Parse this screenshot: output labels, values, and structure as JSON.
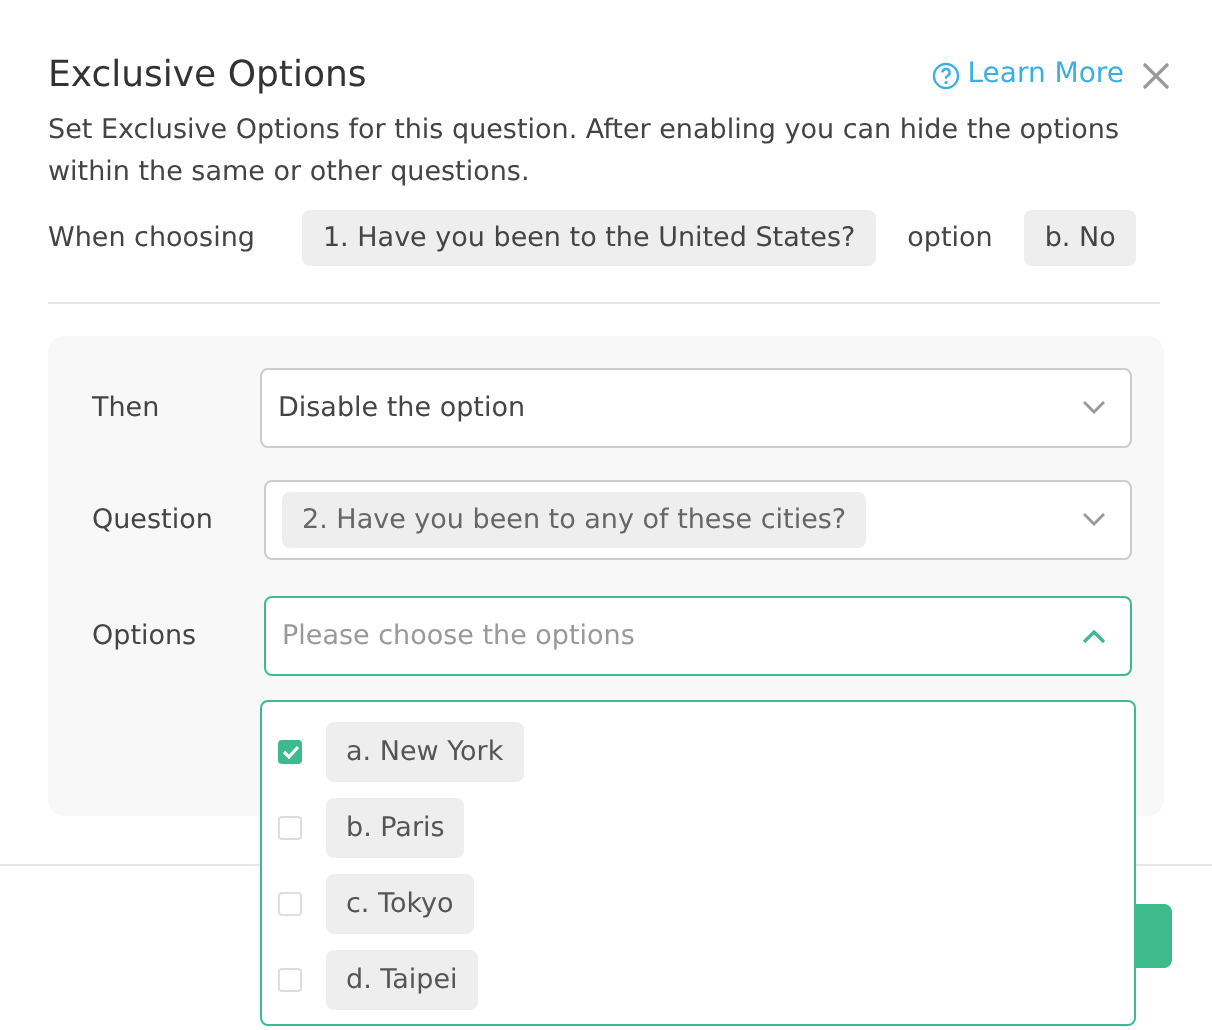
{
  "dialog": {
    "title": "Exclusive Options",
    "help_link": "Learn More",
    "description": "Set Exclusive Options for this question. After enabling you can hide the options within the same or other questions.",
    "condition": {
      "prefix": "When choosing",
      "question": "1. Have you been to the United States?",
      "middle": "option",
      "option": "b. No"
    }
  },
  "form": {
    "then": {
      "label": "Then",
      "value": "Disable the option"
    },
    "question": {
      "label": "Question",
      "value": "2. Have you been to any of these cities?"
    },
    "options": {
      "label": "Options",
      "placeholder": "Please choose the options",
      "expanded": true,
      "items": [
        {
          "letter": "a.",
          "label": "New York",
          "checked": true
        },
        {
          "letter": "b.",
          "label": "Paris",
          "checked": false
        },
        {
          "letter": "c.",
          "label": "Tokyo",
          "checked": false
        },
        {
          "letter": "d.",
          "label": "Taipei",
          "checked": false
        }
      ]
    }
  }
}
